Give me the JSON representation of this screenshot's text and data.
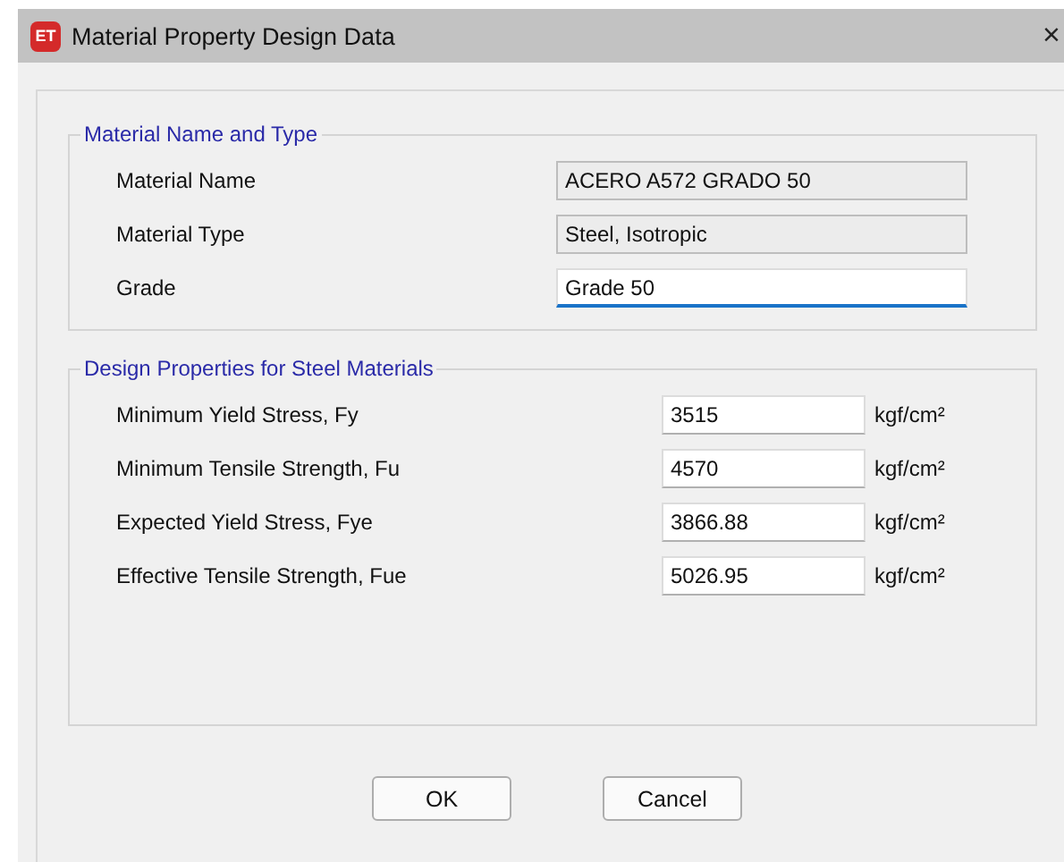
{
  "window": {
    "title": "Material Property Design Data",
    "icon_text": "ET",
    "close": "×"
  },
  "groups": [
    {
      "title": "Material Name and Type",
      "kind": "wide",
      "rows": [
        {
          "label": "Material Name",
          "value": "ACERO A572 GRADO 50",
          "readonly": true,
          "focused": false
        },
        {
          "label": "Material Type",
          "value": "Steel, Isotropic",
          "readonly": true,
          "focused": false
        },
        {
          "label": "Grade",
          "value": "Grade 50",
          "readonly": false,
          "focused": true
        }
      ]
    },
    {
      "title": "Design Properties for Steel Materials",
      "kind": "units",
      "rows": [
        {
          "label": "Minimum Yield Stress, Fy",
          "value": "3515",
          "unit": "kgf/cm²",
          "readonly": false,
          "focused": false
        },
        {
          "label": "Minimum Tensile Strength, Fu",
          "value": "4570",
          "unit": "kgf/cm²",
          "readonly": false,
          "focused": false
        },
        {
          "label": "Expected Yield Stress, Fye",
          "value": "3866.88",
          "unit": "kgf/cm²",
          "readonly": false,
          "focused": false
        },
        {
          "label": "Effective Tensile Strength, Fue",
          "value": "5026.95",
          "unit": "kgf/cm²",
          "readonly": false,
          "focused": false
        }
      ]
    }
  ],
  "buttons": [
    "OK",
    "Cancel"
  ]
}
